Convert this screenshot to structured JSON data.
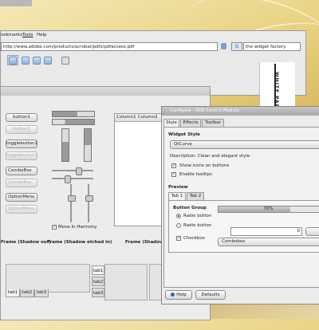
{
  "browser": {
    "menu": [
      "ookmarks",
      "Tools",
      "Help"
    ],
    "url": "http://www.adobe.com/products/acrobat/pdfs/pdfaccess.pdf",
    "search_value": "the widget factory",
    "side_text": "WHITE PAPER"
  },
  "widget_factory": {
    "buttons": [
      "button1",
      "button2",
      "togglebutton1",
      "togglebutton2",
      "ComboBox",
      "ComboBox",
      "OptionMenu",
      "OptionMenu"
    ],
    "columns": [
      "Column1",
      "Column2"
    ],
    "checkbox_label": "Move In Harmony",
    "frame_labels": [
      "Frame (Shadow out)",
      "Frame (Shadow etched in)",
      "Frame (Shadow etc"
    ],
    "tabs": [
      "tab1",
      "tab2",
      "tab3"
    ],
    "vtabs": [
      "tab1",
      "tab2",
      "tab3"
    ]
  },
  "kde": {
    "title": "Configure - KDE Control Module",
    "tabs": [
      "Style",
      "Effects",
      "Toolbar"
    ],
    "widget_style_heading": "Widget Style",
    "style_value": "QtCurve",
    "description": "Description: Clean and elegant style",
    "show_icons": "Show icons on buttons",
    "enable_tooltips": "Enable tooltips",
    "preview_heading": "Preview",
    "preview_tabs": [
      "Tab 1",
      "Tab 2"
    ],
    "button_group": "Button Group",
    "radio1": "Radio button",
    "radio2": "Radio button",
    "checkbox": "Checkbox",
    "progress": "70%",
    "progress_fraction": 0.7,
    "spin_value": "0",
    "combo_value": "Combobox",
    "help": "Help",
    "defaults": "Defaults"
  }
}
